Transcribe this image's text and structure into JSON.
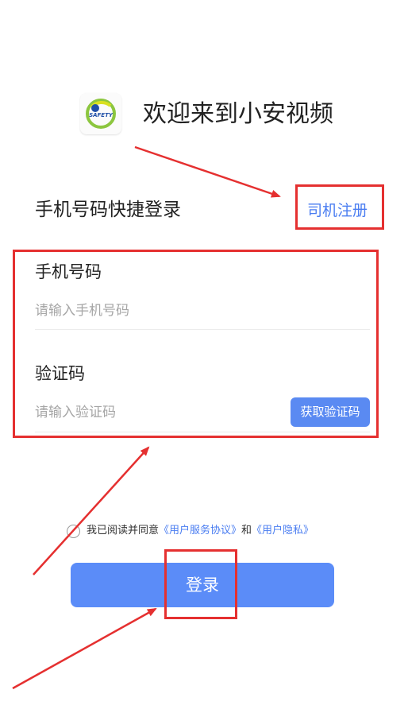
{
  "header": {
    "logo_icon": "safety-logo-icon",
    "logo_text": "SAFETY",
    "title": "欢迎来到小安视频"
  },
  "login": {
    "subtitle": "手机号码快捷登录",
    "register_link": "司机注册"
  },
  "form": {
    "phone": {
      "label": "手机号码",
      "value": "",
      "placeholder": "请输入手机号码"
    },
    "code": {
      "label": "验证码",
      "value": "",
      "placeholder": "请输入验证码",
      "button_label": "获取验证码"
    }
  },
  "agreement": {
    "checked": false,
    "prefix": "我已阅读并同意",
    "service_link": "《用户服务协议》",
    "conjunction": "和",
    "privacy_link": "《用户隐私》"
  },
  "login_button": {
    "label": "登录"
  },
  "colors": {
    "accent": "#5b8cf8",
    "link": "#4a7df1",
    "annotation": "#e53030"
  }
}
